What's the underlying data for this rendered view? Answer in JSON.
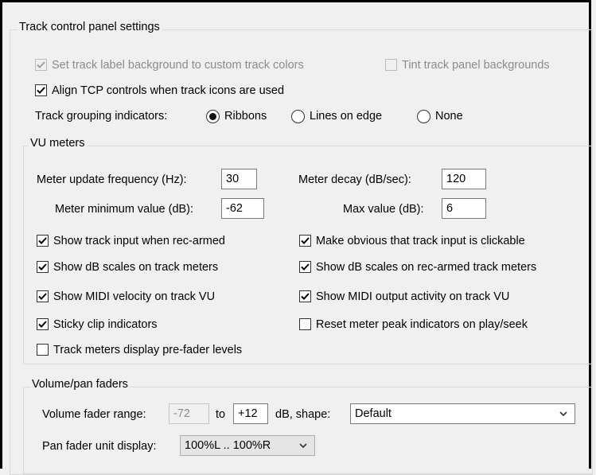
{
  "tcp": {
    "group_title": "Track control panel settings",
    "set_label_bg": {
      "label": "Set track label background to custom track colors",
      "checked": true,
      "disabled": true
    },
    "tint_backgrounds": {
      "label": "Tint track panel backgrounds",
      "checked": false,
      "disabled": true
    },
    "align_controls": {
      "label": "Align TCP controls when track icons are used",
      "checked": true
    },
    "grouping_label": "Track grouping indicators:",
    "grouping_options": [
      "Ribbons",
      "Lines on edge",
      "None"
    ],
    "grouping_selected": "Ribbons"
  },
  "vu": {
    "group_title": "VU meters",
    "update_freq_label": "Meter update frequency (Hz):",
    "update_freq_value": "30",
    "decay_label": "Meter decay (dB/sec):",
    "decay_value": "120",
    "min_label": "Meter minimum value (dB):",
    "min_value": "-62",
    "max_label": "Max value (dB):",
    "max_value": "6",
    "checks": [
      {
        "label": "Show track input when rec-armed",
        "checked": true
      },
      {
        "label": "Make obvious that track input is clickable",
        "checked": true
      },
      {
        "label": "Show dB scales on track meters",
        "checked": true
      },
      {
        "label": "Show dB scales on rec-armed track meters",
        "checked": true
      },
      {
        "label": "Show MIDI velocity on track VU",
        "checked": true
      },
      {
        "label": "Show MIDI output activity on track VU",
        "checked": true
      },
      {
        "label": "Sticky clip indicators",
        "checked": true
      },
      {
        "label": "Reset meter peak indicators on play/seek",
        "checked": false
      },
      {
        "label": "Track meters display pre-fader levels",
        "checked": false
      }
    ]
  },
  "faders": {
    "group_title": "Volume/pan faders",
    "range_label": "Volume fader range:",
    "range_min": "-72",
    "to_label": "to",
    "range_max": "+12",
    "shape_label": "dB, shape:",
    "shape_value": "Default",
    "pan_label": "Pan fader unit display:",
    "pan_value": "100%L .. 100%R"
  },
  "colors": {
    "background": "#f0f0f0",
    "frame": "#000000",
    "group_border": "#d9d9d9"
  }
}
